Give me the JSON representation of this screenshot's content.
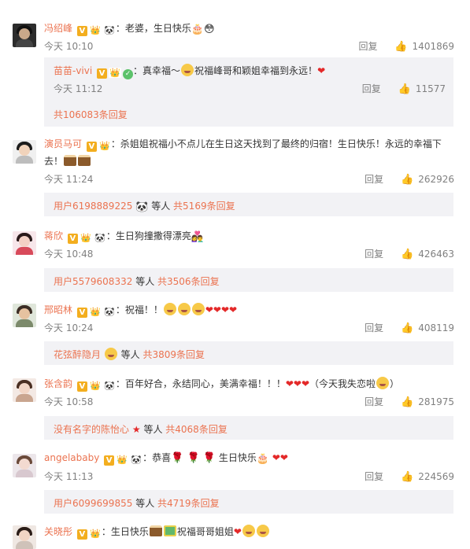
{
  "comments": [
    {
      "user": "冯绍峰",
      "text": "：老婆，生日快乐",
      "emoji_tail": "🎂😳",
      "time": "今天 10:10",
      "reply": "回复",
      "likes": "1401869"
    },
    {
      "user": "苗苗-vivi",
      "text_a": "：真幸福～",
      "text_b": "祝福峰哥和颖姐幸福到永远！",
      "time": "今天 11:12",
      "reply": "回复",
      "likes": "11577",
      "more": "共106083条回复"
    },
    {
      "user": "演员马可",
      "text": "：杀姐姐祝福小不点儿在生日这天找到了最终的归宿！生日快乐！永远的幸福下去！",
      "time": "今天 11:24",
      "reply": "回复",
      "likes": "262926",
      "sub_user": "用户6198889225",
      "sub_mid": "等人",
      "sub_more": "共5169条回复"
    },
    {
      "user": "蒋欣",
      "text": "：生日狗撞撒得漂亮",
      "time": "今天 10:48",
      "reply": "回复",
      "likes": "426463",
      "sub_user": "用户5579608332",
      "sub_mid": "等人",
      "sub_more": "共3506条回复"
    },
    {
      "user": "邢昭林",
      "text": "：祝福！！",
      "time": "今天 10:24",
      "reply": "回复",
      "likes": "408119",
      "sub_user": "花弦醉隐月",
      "sub_mid": "等人",
      "sub_more": "共3809条回复"
    },
    {
      "user": "张含韵",
      "text": "：百年好合，永结同心，美满幸福！！！",
      "text_b": "（今天我失恋啦",
      "text_c": "）",
      "time": "今天 10:58",
      "reply": "回复",
      "likes": "281975",
      "sub_user": "没有名字的陈怡心",
      "sub_mid": "等人",
      "sub_more": "共4068条回复"
    },
    {
      "user": "angelababy",
      "text_a": "：恭喜",
      "text_b": "生日快乐",
      "time": "今天 11:13",
      "reply": "回复",
      "likes": "224569",
      "sub_user": "用户6099699855",
      "sub_mid": "等人",
      "sub_more": "共4719条回复"
    },
    {
      "user": "关晓彤",
      "text_a": "：生日快乐",
      "text_b": "祝福哥哥姐姐"
    }
  ],
  "icons": {
    "v_badge": "V",
    "crown": "👑",
    "panda": "🐼",
    "thumb": "👍",
    "heart": "❤",
    "rose": "🌹",
    "star": "★"
  },
  "colors": {
    "username": "#eb7350",
    "subbox": "#f2f2f5",
    "meta": "#808080",
    "heart": "#e42929"
  }
}
